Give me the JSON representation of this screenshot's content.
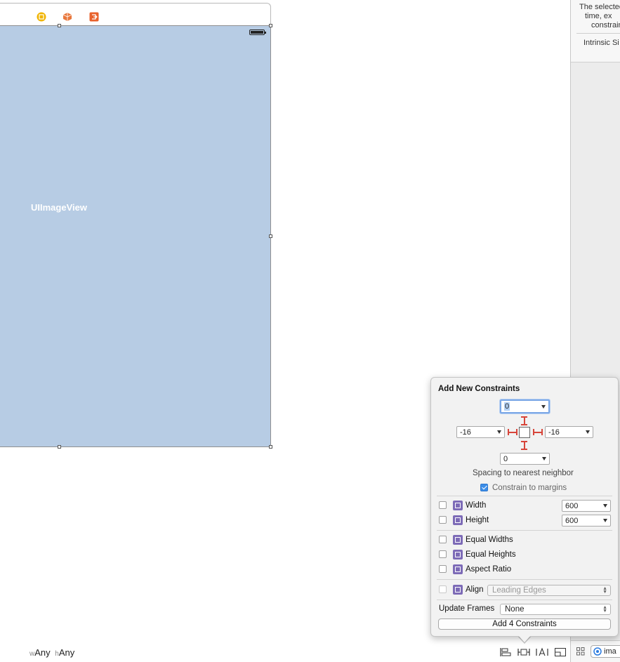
{
  "canvas": {
    "image_view_label": "UIImageView",
    "size_class": {
      "w_prefix": "w",
      "w_value": "Any",
      "h_prefix": "h",
      "h_value": "Any"
    }
  },
  "scene_dock": {
    "icons": [
      "view-controller-icon",
      "first-responder-icon",
      "exit-icon"
    ]
  },
  "inspector": {
    "text_lines": [
      "The selected",
      "time, ex",
      "constrain"
    ],
    "intrinsic_size_label": "Intrinsic Si",
    "bottom_field_text": "ima"
  },
  "popover": {
    "title": "Add New Constraints",
    "spacing": {
      "top": "0",
      "left": "-16",
      "right": "-16",
      "bottom": "0"
    },
    "spacing_caption": "Spacing to nearest neighbor",
    "constrain_to_margins": {
      "label": "Constrain to margins",
      "checked": true
    },
    "width": {
      "label": "Width",
      "value": "600",
      "checked": false
    },
    "height": {
      "label": "Height",
      "value": "600",
      "checked": false
    },
    "equal_widths": {
      "label": "Equal Widths",
      "checked": false
    },
    "equal_heights": {
      "label": "Equal Heights",
      "checked": false
    },
    "aspect_ratio": {
      "label": "Aspect Ratio",
      "checked": false
    },
    "align": {
      "label": "Align",
      "value": "Leading Edges",
      "checked": false
    },
    "update_frames": {
      "label": "Update Frames",
      "value": "None"
    },
    "add_button_label": "Add 4 Constraints"
  },
  "colors": {
    "canvas_fill": "#b7cce4",
    "constraint_red": "#d7453a",
    "icon_purple": "#7d6bb7",
    "accent_blue": "#3b8de8"
  }
}
